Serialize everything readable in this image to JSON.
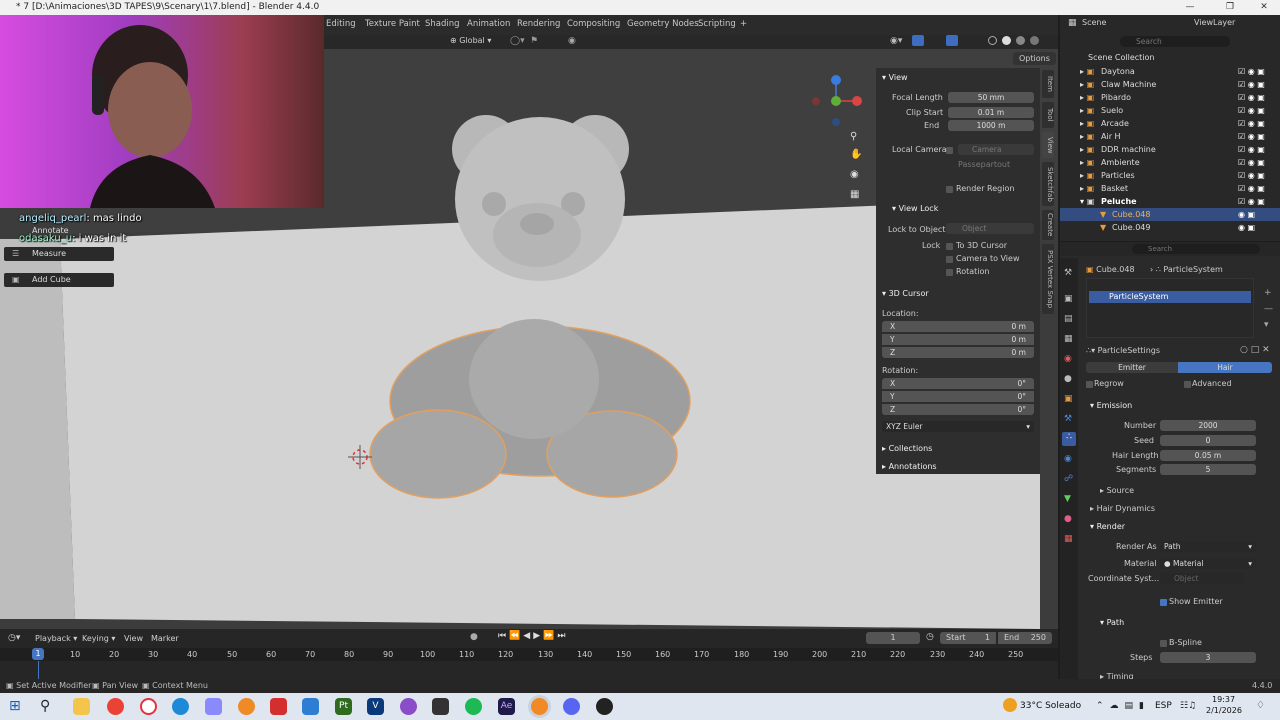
{
  "window": {
    "title": "* 7 [D:\\Animaciones\\3D TAPES\\9\\Scenary\\1\\7.blend] - Blender 4.4.0"
  },
  "workspaces": [
    "Editing",
    "Texture Paint",
    "Shading",
    "Animation",
    "Rendering",
    "Compositing",
    "Geometry Nodes",
    "Scripting"
  ],
  "viewport_header": {
    "transform": "Global",
    "options": "Options"
  },
  "chat": [
    {
      "user": "angeliq_pearl",
      "msg": ": mas lindo"
    },
    {
      "user": "odasaku_u",
      "msg": ": i was in it"
    }
  ],
  "toolbar": {
    "annotate": "Annotate",
    "measure": "Measure",
    "add_cube": "Add Cube"
  },
  "npanel": {
    "view_header": "View",
    "focal_length_label": "Focal Length",
    "focal_length": "50 mm",
    "clip_start_label": "Clip Start",
    "clip_start": "0.01 m",
    "end_label": "End",
    "end": "1000 m",
    "local_camera_label": "Local Camera",
    "camera_placeholder": "Camera",
    "passepartout": "Passepartout",
    "render_region": "Render Region",
    "view_lock_header": "View Lock",
    "lock_to_object_label": "Lock to Object",
    "object_placeholder": "Object",
    "lock_label": "Lock",
    "to_3d_cursor": "To 3D Cursor",
    "camera_to_view": "Camera to View",
    "rotation_lock": "Rotation",
    "cursor_header": "3D Cursor",
    "location_label": "Location:",
    "rotation_label": "Rotation:",
    "x": "X",
    "y": "Y",
    "z": "Z",
    "loc_x": "0 m",
    "loc_y": "0 m",
    "loc_z": "0 m",
    "rot_x": "0°",
    "rot_y": "0°",
    "rot_z": "0°",
    "euler": "XYZ Euler",
    "collections": "Collections",
    "annotations": "Annotations"
  },
  "sidetabs": [
    "Item",
    "Tool",
    "View",
    "Sketchfab",
    "Create",
    "PSX Vertex Snap"
  ],
  "outliner": {
    "scene": "Scene",
    "view_layer": "ViewLayer",
    "search_placeholder": "Search",
    "root": "Scene Collection",
    "items": [
      "Daytona",
      "Claw Machine",
      "Pibardo",
      "Suelo",
      "Arcade",
      "Air H",
      "DDR machine",
      "Ambiente",
      "Particles",
      "Basket",
      "Peluche",
      "Cube.048",
      "Cube.049"
    ]
  },
  "properties": {
    "search_placeholder": "Search",
    "object": "Cube.048",
    "particle_system_crumb": "ParticleSystem",
    "system_item": "ParticleSystem",
    "settings": "ParticleSettings",
    "emitter_tab": "Emitter",
    "hair_tab": "Hair",
    "regrow": "Regrow",
    "advanced": "Advanced",
    "emission_header": "Emission",
    "number_label": "Number",
    "number": "2000",
    "seed_label": "Seed",
    "seed": "0",
    "hair_length_label": "Hair Length",
    "hair_length": "0.05 m",
    "segments_label": "Segments",
    "segments": "5",
    "source": "Source",
    "hair_dynamics": "Hair Dynamics",
    "render_header": "Render",
    "render_as_label": "Render As",
    "render_as": "Path",
    "material_label": "Material",
    "material": "Material",
    "coord_label": "Coordinate Syst...",
    "coord_placeholder": "Object",
    "show_emitter": "Show Emitter",
    "path_header": "Path",
    "bspline": "B-Spline",
    "steps_label": "Steps",
    "steps": "3",
    "timing": "Timing"
  },
  "timeline": {
    "playback": "Playback",
    "keying": "Keying",
    "view": "View",
    "marker": "Marker",
    "current_frame": "1",
    "start_label": "Start",
    "start": "1",
    "end_label": "End",
    "end": "250",
    "ticks": [
      "1",
      "10",
      "20",
      "30",
      "40",
      "50",
      "60",
      "70",
      "80",
      "90",
      "100",
      "110",
      "120",
      "130",
      "140",
      "150",
      "160",
      "170",
      "180",
      "190",
      "200",
      "210",
      "220",
      "230",
      "240",
      "250"
    ]
  },
  "status": {
    "set_active_modifier": "Set Active Modifier",
    "pan_view": "Pan View",
    "context_menu": "Context Menu",
    "version": "4.4.0"
  },
  "taskbar": {
    "weather": "33°C Soleado",
    "lang": "ESP",
    "time": "19:37",
    "date": "2/1/2026"
  }
}
